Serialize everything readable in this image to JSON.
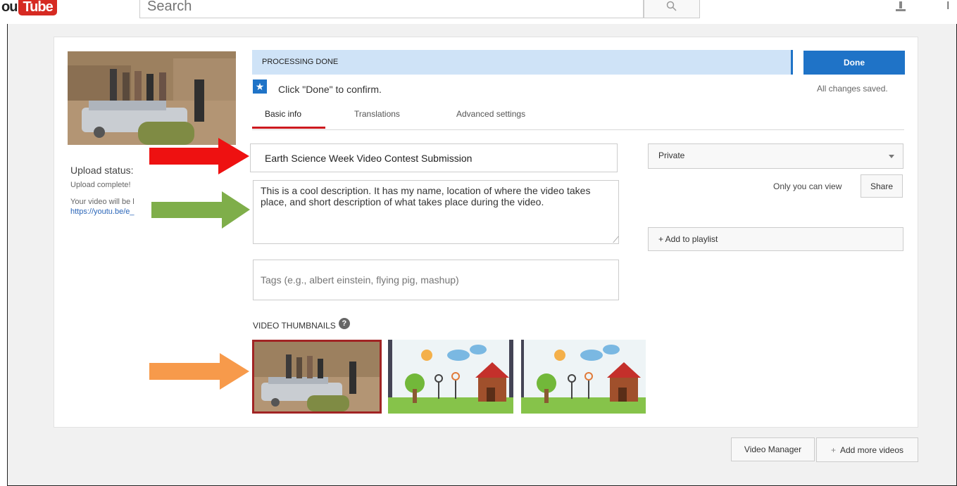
{
  "header": {
    "logo_you": "ou",
    "logo_tube": "Tube",
    "search_placeholder": "Search",
    "right_letter": "I"
  },
  "upload": {
    "status_title": "Upload status:",
    "status_complete": "Upload complete!",
    "live_text": "Your video will be l",
    "link_text": "https://youtu.be/e_"
  },
  "processing": {
    "label": "PROCESSING DONE",
    "done_button": "Done",
    "saved_text": "All changes saved.",
    "confirm_text": "Click \"Done\" to confirm.",
    "star_glyph": "★"
  },
  "tabs": [
    {
      "label": "Basic info",
      "active": true
    },
    {
      "label": "Translations",
      "active": false
    },
    {
      "label": "Advanced settings",
      "active": false
    }
  ],
  "form": {
    "title_value": "Earth Science Week Video Contest Submission",
    "description_value": "This is a cool description. It has my name, location of where the video takes place, and short description of what takes place during the video.",
    "tags_placeholder": "Tags (e.g., albert einstein, flying pig, mashup)"
  },
  "privacy": {
    "selected": "Private",
    "note": "Only you can view",
    "share_button": "Share",
    "playlist_button": "+ Add to playlist"
  },
  "thumbnails": {
    "label": "VIDEO THUMBNAILS",
    "help_glyph": "?"
  },
  "footer": {
    "video_manager": "Video Manager",
    "add_more_plus": "+",
    "add_more": "Add more videos"
  },
  "colors": {
    "arrow_title": "#ee1111",
    "arrow_description": "#7fae4a",
    "arrow_thumbnail": "#f79a4b",
    "accent_blue": "#1f73c7",
    "selected_thumb_border": "#a12424"
  }
}
